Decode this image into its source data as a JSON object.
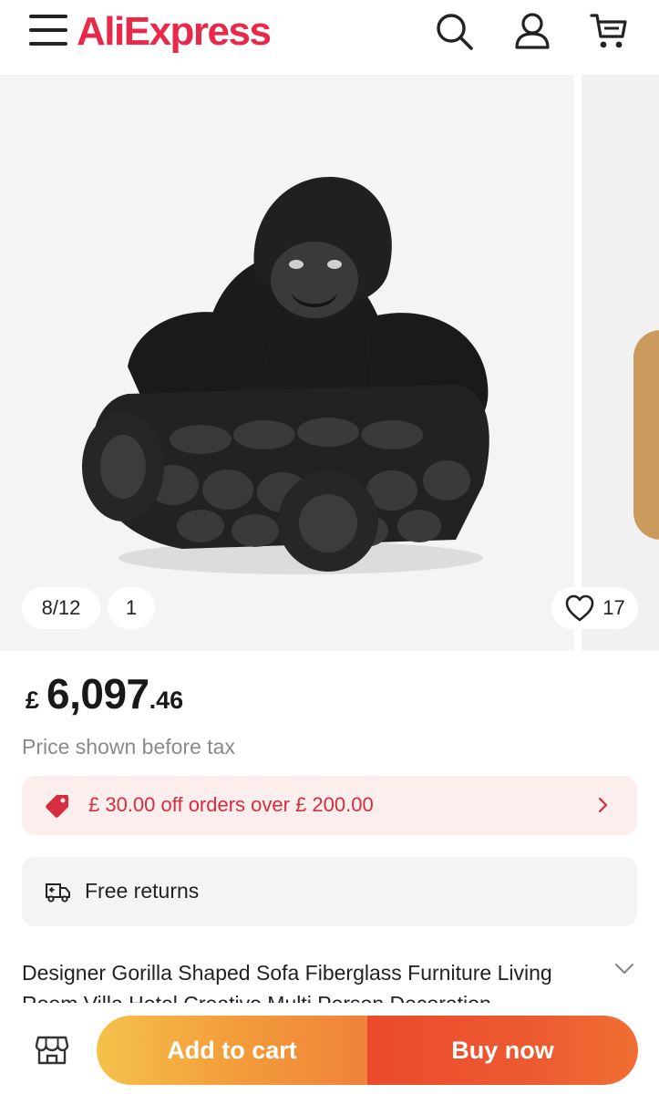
{
  "header": {
    "logo_prefix": "Ali",
    "logo_suffix": "Express",
    "icons": [
      "menu-icon",
      "search-icon",
      "account-icon",
      "cart-icon"
    ],
    "brand_color": "#e8294a"
  },
  "gallery": {
    "counter": "8/12",
    "secondary_badge": "1",
    "likes": "17"
  },
  "price": {
    "currency": "£",
    "integer": "6,097",
    "decimal": ".46",
    "note": "Price shown before tax"
  },
  "coupon": {
    "text": "£ 30.00 off orders over  £ 200.00",
    "color": "#d62d3f"
  },
  "returns": {
    "text": "Free returns"
  },
  "product": {
    "title": "Designer Gorilla Shaped Sofa Fiberglass Furniture Living Room Villa Hotel Creative Multi Person Decoration"
  },
  "actions": {
    "add_to_cart": "Add to cart",
    "buy_now": "Buy now"
  }
}
